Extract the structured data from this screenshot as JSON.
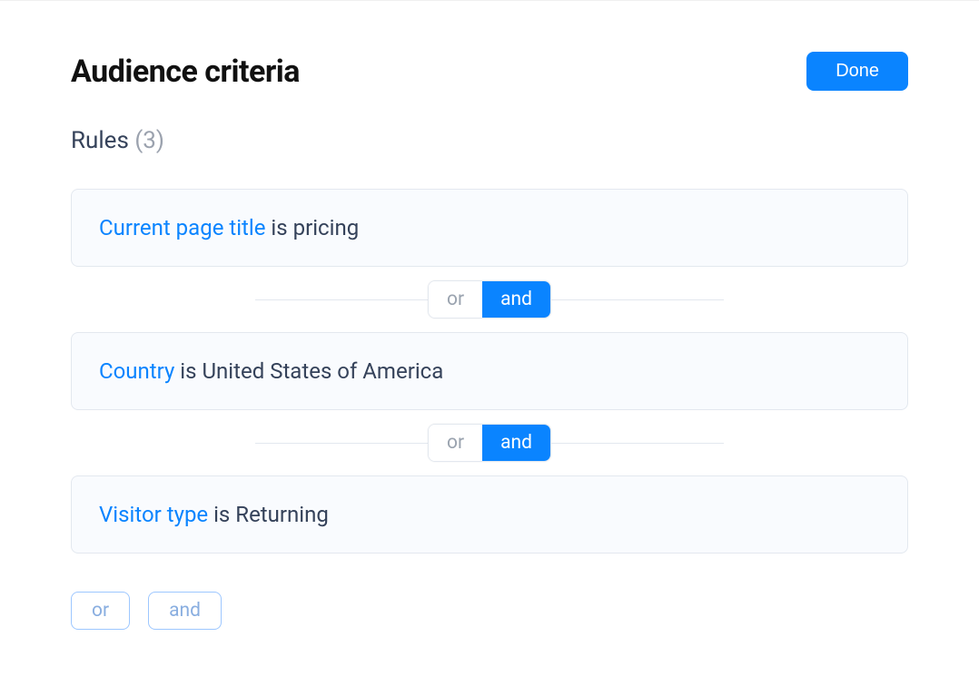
{
  "header": {
    "title": "Audience criteria",
    "done_label": "Done"
  },
  "rules_section": {
    "label": "Rules",
    "count_display": "(3)"
  },
  "rules": [
    {
      "attribute": "Current page title",
      "operator": "is",
      "value": "pricing"
    },
    {
      "attribute": "Country",
      "operator": "is",
      "value": "United States of America"
    },
    {
      "attribute": "Visitor type",
      "operator": "is",
      "value": "Returning"
    }
  ],
  "connectors": [
    {
      "or_label": "or",
      "and_label": "and",
      "active": "and"
    },
    {
      "or_label": "or",
      "and_label": "and",
      "active": "and"
    }
  ],
  "add_buttons": {
    "or_label": "or",
    "and_label": "and"
  }
}
